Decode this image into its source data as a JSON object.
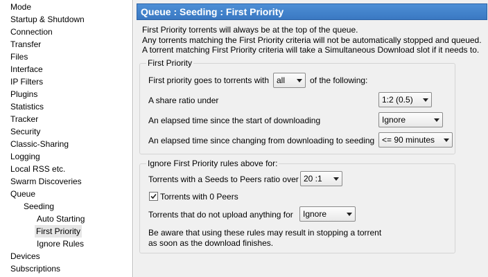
{
  "sidebar": {
    "items": [
      {
        "label": "Mode"
      },
      {
        "label": "Startup & Shutdown"
      },
      {
        "label": "Connection"
      },
      {
        "label": "Transfer"
      },
      {
        "label": "Files"
      },
      {
        "label": "Interface"
      },
      {
        "label": "IP Filters"
      },
      {
        "label": "Plugins"
      },
      {
        "label": "Statistics"
      },
      {
        "label": "Tracker"
      },
      {
        "label": "Security"
      },
      {
        "label": "Classic-Sharing"
      },
      {
        "label": "Logging"
      },
      {
        "label": "Local RSS etc."
      },
      {
        "label": "Swarm Discoveries"
      },
      {
        "label": "Queue"
      },
      {
        "label": "Seeding"
      },
      {
        "label": "Auto Starting"
      },
      {
        "label": "First Priority",
        "selected": true
      },
      {
        "label": "Ignore Rules"
      },
      {
        "label": "Devices"
      },
      {
        "label": "Subscriptions"
      }
    ]
  },
  "header": {
    "title": "Queue : Seeding : First Priority"
  },
  "intro": {
    "line1": "First Priority torrents will always be at the top of the queue.",
    "line2": "Any torrents matching the First Priority criteria will not be automatically stopped and queued.",
    "line3": "A torrent matching First Priority criteria will take a Simultaneous Download slot if it needs to."
  },
  "first_priority": {
    "group_title": "First Priority",
    "goes_to_prefix": "First priority goes to torrents with",
    "match_value": "all",
    "goes_to_suffix": "of the following:",
    "share_ratio_label": "A share ratio under",
    "share_ratio_value": "1:2 (0.5)",
    "elapsed_download_label": "An elapsed time since the start of downloading",
    "elapsed_download_value": "Ignore",
    "elapsed_seeding_label": "An elapsed time since changing from downloading to seeding",
    "elapsed_seeding_value": "<= 90 minutes"
  },
  "ignore_rules": {
    "group_title": "Ignore First Priority rules above for:",
    "seeds_peers_label": "Torrents with a Seeds to Peers ratio over",
    "seeds_peers_value": "20 :1",
    "zero_peers_label": "Torrents with 0 Peers",
    "zero_peers_checked": true,
    "no_upload_label": "Torrents that do not upload anything for",
    "no_upload_value": "Ignore",
    "warning_line1": "Be aware that using these rules may result in stopping a torrent",
    "warning_line2": "as soon as the download finishes."
  }
}
